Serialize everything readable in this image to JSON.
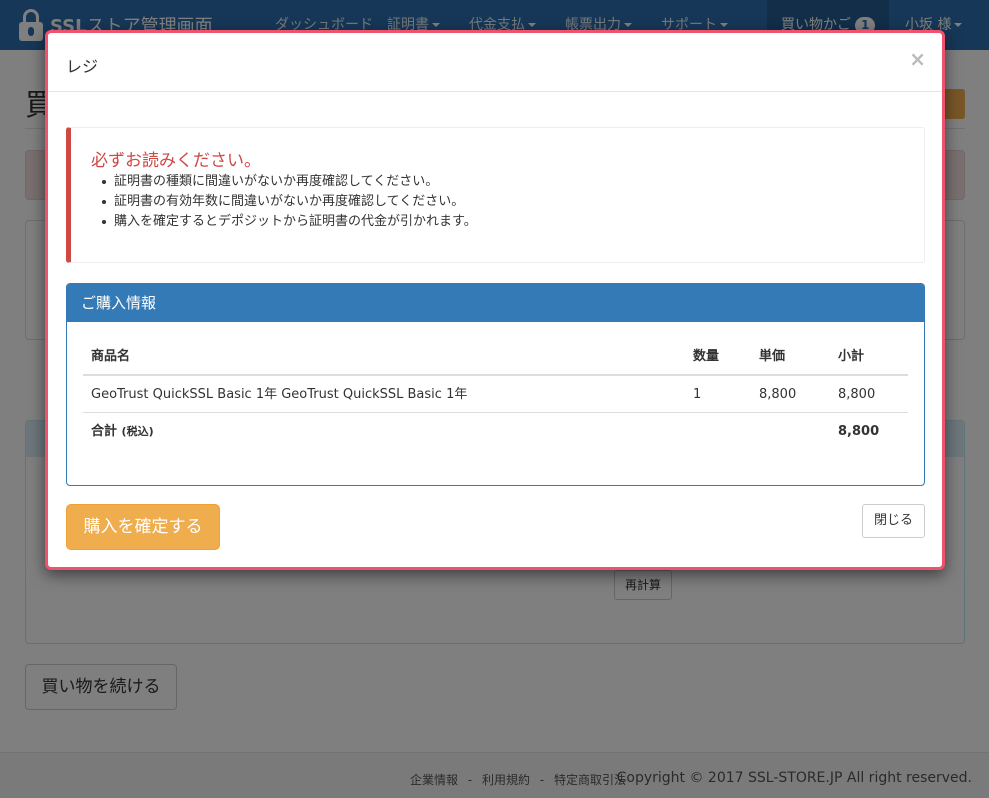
{
  "navbar": {
    "brand_bold": "SSL",
    "brand_rest": "ストア管理画面",
    "items": [
      {
        "label": "ダッシュボード",
        "dropdown": false
      },
      {
        "label": "証明書",
        "dropdown": true
      },
      {
        "label": "代金支払",
        "dropdown": true
      },
      {
        "label": "帳票出力",
        "dropdown": true
      },
      {
        "label": "サポート",
        "dropdown": true
      }
    ],
    "cart_label": "買い物かご",
    "cart_count": "1",
    "user_label": "小坂 様"
  },
  "background": {
    "page_title": "買",
    "recalc_label": "再計算",
    "continue_label": "買い物を続ける"
  },
  "footer": {
    "links": [
      "企業情報",
      "利用規約",
      "特定商取引法"
    ],
    "separator": "-",
    "copyright": "Copyright © 2017 SSL-STORE.JP All right reserved."
  },
  "modal": {
    "title": "レジ",
    "close_symbol": "×",
    "notice": {
      "title": "必ずお読みください。",
      "items": [
        "証明書の種類に間違いがないか再度確認してください。",
        "証明書の有効年数に間違いがないか再度確認してください。",
        "購入を確定するとデポジットから証明書の代金が引かれます。"
      ]
    },
    "purchase": {
      "heading": "ご購入情報",
      "columns": [
        "商品名",
        "数量",
        "単価",
        "小計"
      ],
      "rows": [
        {
          "name": "GeoTrust QuickSSL Basic 1年 GeoTrust QuickSSL Basic 1年",
          "qty": "1",
          "price": "8,800",
          "subtotal": "8,800"
        }
      ],
      "total_label": "合計",
      "total_note": "(税込)",
      "total_value": "8,800"
    },
    "confirm_label": "購入を確定する",
    "close_label": "閉じる"
  },
  "colors": {
    "navbar": "#2c6fae",
    "panel": "#337ab7",
    "danger": "#ce4844",
    "warning": "#f0ad4e",
    "modal_border": "#f0526e"
  }
}
